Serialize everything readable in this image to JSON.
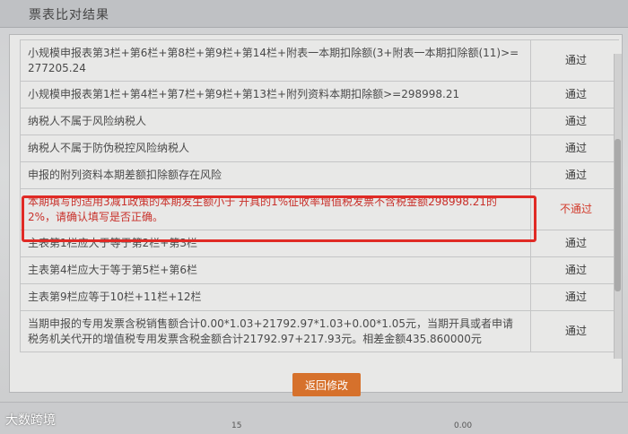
{
  "window": {
    "title": "票表比对结果"
  },
  "rows": [
    {
      "message": "小规模申报表第3栏+第6栏+第8栏+第9栏+第14栏+附表一本期扣除额(3+附表一本期扣除额(11)>= 277205.24",
      "result": "通过",
      "failed": false
    },
    {
      "message": "小规模申报表第1栏+第4栏+第7栏+第9栏+第13栏+附列资料本期扣除额>=298998.21",
      "result": "通过",
      "failed": false
    },
    {
      "message": "纳税人不属于风险纳税人",
      "result": "通过",
      "failed": false
    },
    {
      "message": "纳税人不属于防伪税控风险纳税人",
      "result": "通过",
      "failed": false
    },
    {
      "message": "申报的附列资料本期差额扣除额存在风险",
      "result": "通过",
      "failed": false
    },
    {
      "message": "本期填写的适用3减1政策的本期发生额小于 开具的1%征收率增值税发票不含税金额298998.21的2%，请确认填写是否正确。",
      "result": "不通过",
      "failed": true
    },
    {
      "message": "主表第1栏应大于等于第2栏+第3栏",
      "result": "通过",
      "failed": false
    },
    {
      "message": "主表第4栏应大于等于第5栏+第6栏",
      "result": "通过",
      "failed": false
    },
    {
      "message": "主表第9栏应等于10栏+11栏+12栏",
      "result": "通过",
      "failed": false
    },
    {
      "message": "当期申报的专用发票含税销售额合计0.00*1.03+21792.97*1.03+0.00*1.05元，当期开具或者申请税务机关代开的增值税专用发票含税金额合计21792.97+217.93元。相差金额435.860000元",
      "result": "通过",
      "failed": false
    }
  ],
  "buttons": {
    "back": "返回修改"
  },
  "footer": {
    "brand": "大数跨境",
    "num1": "15",
    "num2": "0.00"
  },
  "colors": {
    "fail_text": "#d23a2b",
    "highlight_border": "#e02a25",
    "button_bg": "#d6712c"
  }
}
